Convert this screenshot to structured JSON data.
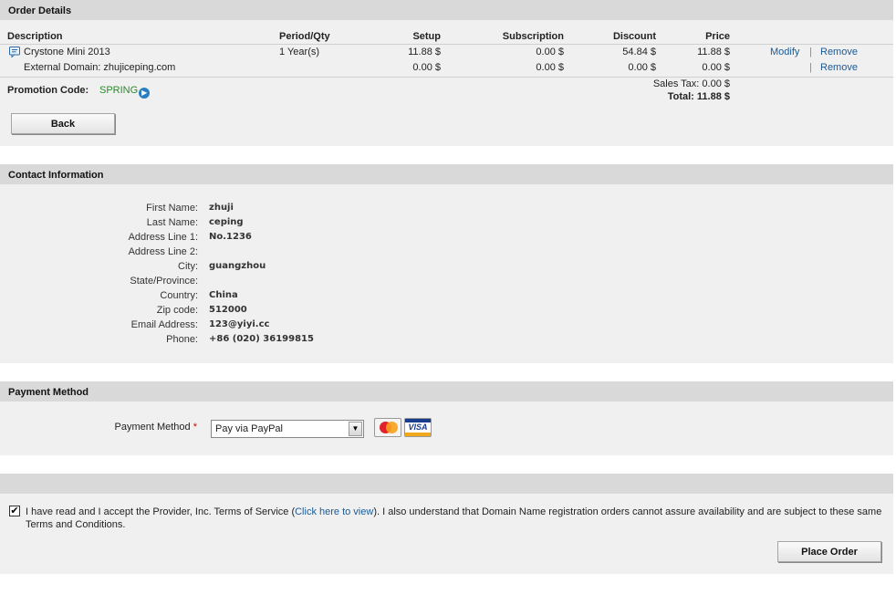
{
  "order": {
    "title": "Order Details",
    "headers": {
      "description": "Description",
      "period": "Period/Qty",
      "setup": "Setup",
      "subscription": "Subscription",
      "discount": "Discount",
      "price": "Price"
    },
    "items": [
      {
        "description": "Crystone Mini 2013",
        "period": "1 Year(s)",
        "setup": "11.88 $",
        "subscription": "0.00 $",
        "discount": "54.84 $",
        "price": "11.88 $",
        "modify": "Modify",
        "remove": "Remove"
      },
      {
        "description": "External Domain: zhujiceping.com",
        "period": "",
        "setup": "0.00 $",
        "subscription": "0.00 $",
        "discount": "0.00 $",
        "price": "0.00 $",
        "remove": "Remove"
      }
    ],
    "separator": "|",
    "promo_label": "Promotion Code:",
    "promo_code": "SPRING",
    "sales_tax": "Sales Tax: 0.00 $",
    "total": "Total: 11.88 $",
    "back_label": "Back"
  },
  "contact": {
    "title": "Contact Information",
    "fields": [
      {
        "label": "First Name:",
        "value": "zhuji"
      },
      {
        "label": "Last Name:",
        "value": "ceping"
      },
      {
        "label": "Address Line 1:",
        "value": "No.1236"
      },
      {
        "label": "Address Line 2:",
        "value": ""
      },
      {
        "label": "City:",
        "value": "guangzhou"
      },
      {
        "label": "State/Province:",
        "value": ""
      },
      {
        "label": "Country:",
        "value": "China"
      },
      {
        "label": "Zip code:",
        "value": "512000"
      },
      {
        "label": "Email Address:",
        "value": "123@yiyi.cc"
      },
      {
        "label": "Phone:",
        "value": "+86 (020) 36199815"
      }
    ]
  },
  "payment": {
    "title": "Payment Method",
    "label": "Payment Method",
    "required": "*",
    "selected": "Pay via PayPal",
    "card_icons": [
      "mastercard-icon",
      "visa-icon"
    ],
    "visa_text": "VISA"
  },
  "terms": {
    "checked": true,
    "text_before": "I have read and I accept the Provider, Inc. Terms of Service (",
    "link": "Click here to view",
    "text_after": "). I also understand that Domain Name registration orders cannot assure availability and are subject to these same Terms and Conditions.",
    "place_order_label": "Place Order"
  },
  "colors": {
    "header_bg": "#d9d9d9",
    "section_bg": "#f0f0f0",
    "link": "#1a5a96",
    "promo": "#2a8a2a"
  }
}
